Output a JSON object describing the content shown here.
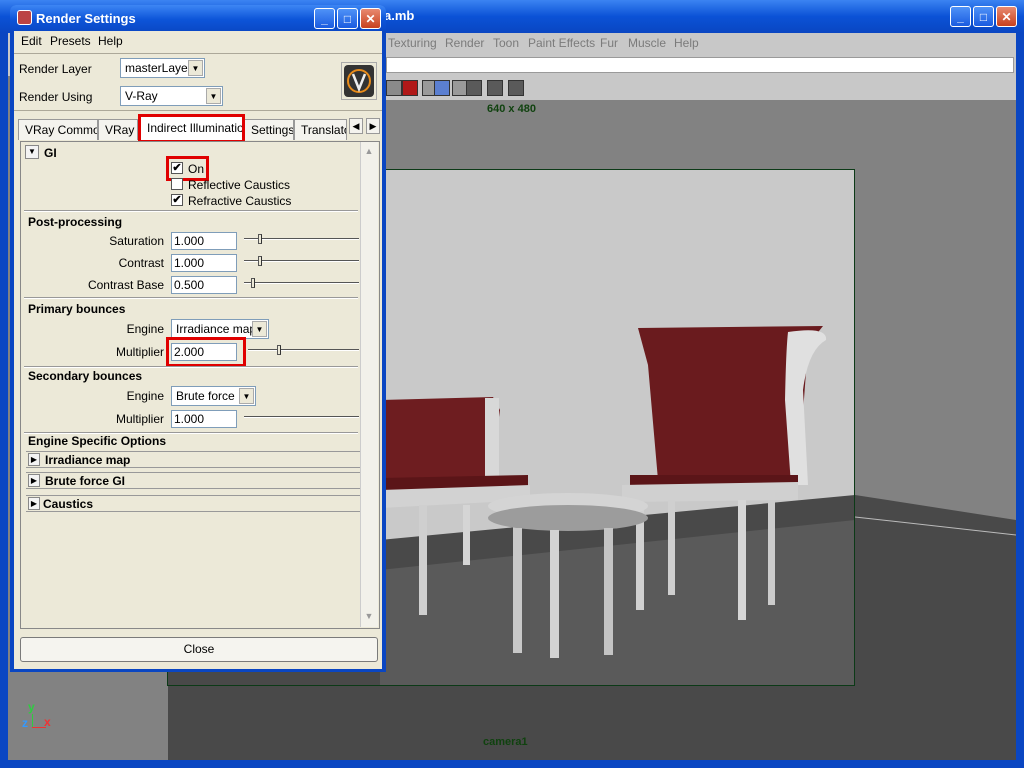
{
  "maya": {
    "title": "a.mb",
    "menus": [
      "Texturing",
      "Render",
      "Toon",
      "Paint Effects",
      "Fur",
      "Muscle",
      "Help"
    ],
    "resolution": "640 x 480",
    "camera": "camera1",
    "axis": {
      "y": "y",
      "z": "z",
      "x": "x"
    }
  },
  "dialog": {
    "title": "Render Settings",
    "menus": [
      "Edit",
      "Presets",
      "Help"
    ],
    "render_layer_label": "Render Layer",
    "render_layer_value": "masterLayer",
    "render_using_label": "Render Using",
    "render_using_value": "V-Ray",
    "tabs": [
      "VRay Common",
      "VRay",
      "Indirect Illumination",
      "Settings",
      "Translator"
    ],
    "gi": {
      "header": "GI",
      "on_label": "On",
      "on_checked": "✔",
      "reflective_label": "Reflective Caustics",
      "refractive_label": "Refractive Caustics",
      "refractive_checked": "✔"
    },
    "post": {
      "header": "Post-processing",
      "saturation_label": "Saturation",
      "saturation_value": "1.000",
      "contrast_label": "Contrast",
      "contrast_value": "1.000",
      "contrast_base_label": "Contrast Base",
      "contrast_base_value": "0.500"
    },
    "primary": {
      "header": "Primary bounces",
      "engine_label": "Engine",
      "engine_value": "Irradiance map",
      "multiplier_label": "Multiplier",
      "multiplier_value": "2.000"
    },
    "secondary": {
      "header": "Secondary bounces",
      "engine_label": "Engine",
      "engine_value": "Brute force",
      "multiplier_label": "Multiplier",
      "multiplier_value": "1.000"
    },
    "engine_specific": "Engine Specific Options",
    "folds": [
      "Irradiance map",
      "Brute force GI",
      "Caustics"
    ],
    "close_label": "Close"
  },
  "colors": {
    "highlight": "#e00000",
    "xp_blue": "#0a46c2",
    "gate": "#0c3a17"
  }
}
